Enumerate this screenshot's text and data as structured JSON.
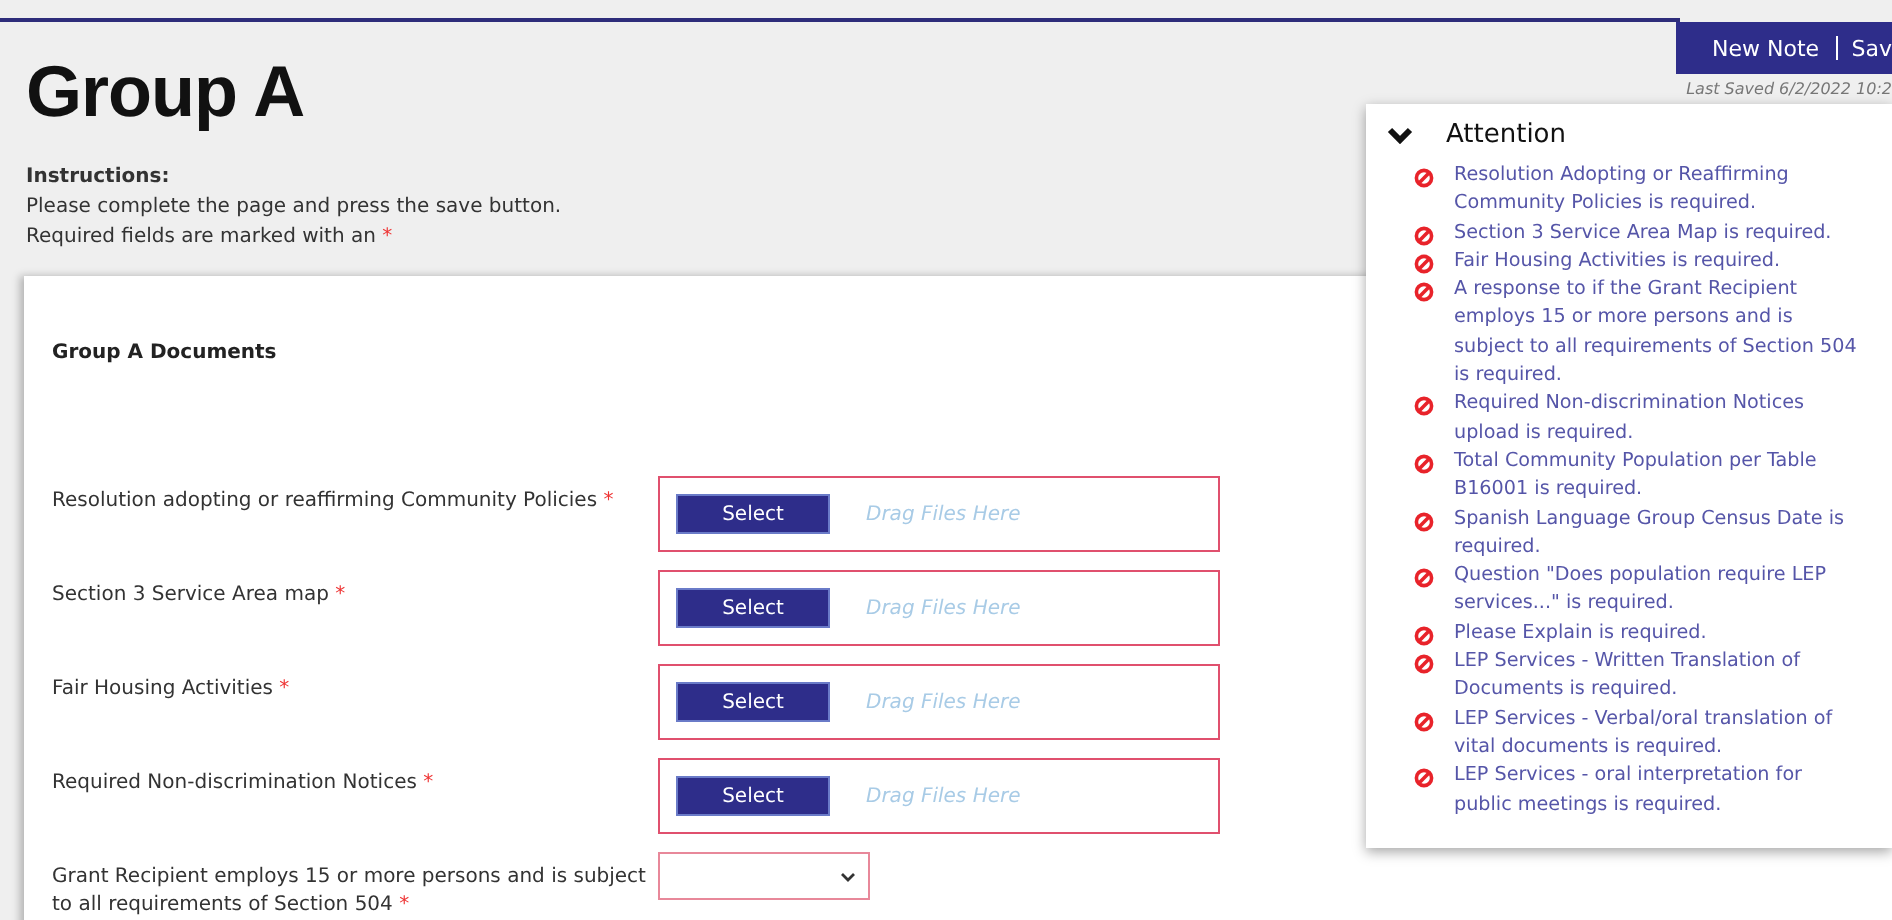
{
  "header": {
    "title": "Group A",
    "actions": [
      "New Note",
      "Sav"
    ],
    "last_saved": "Last Saved 6/2/2022 10:2"
  },
  "instructions": {
    "heading": "Instructions:",
    "lines": [
      "Please complete the page and press the save button.",
      "Required fields are marked with an"
    ],
    "mark": "*"
  },
  "section": {
    "title": "Group A Documents",
    "fields": [
      {
        "kind": "file",
        "label": "Resolution adopting or reaffirming Community Policies",
        "required_mark": "*",
        "button": "Select",
        "hint": "Drag Files Here"
      },
      {
        "kind": "file",
        "label": "Section 3 Service Area map",
        "required_mark": "*",
        "button": "Select",
        "hint": "Drag Files Here"
      },
      {
        "kind": "file",
        "label": "Fair Housing Activities",
        "required_mark": "*",
        "button": "Select",
        "hint": "Drag Files Here"
      },
      {
        "kind": "file",
        "label": "Required Non-discrimination Notices",
        "required_mark": "*",
        "button": "Select",
        "hint": "Drag Files Here"
      },
      {
        "kind": "select",
        "label": "Grant Recipient employs 15 or more persons and is subject to all requirements of Section 504",
        "required_mark": "*"
      }
    ]
  },
  "attention": {
    "title": "Attention",
    "expanded": true,
    "messages": [
      "Resolution Adopting or Reaffirming Community Policies is required.",
      "Section 3 Service Area Map is required.",
      "Fair Housing Activities is required.",
      "A response to if the Grant Recipient employs 15 or more persons and is subject to all requirements of Section 504 is required.",
      "Required Non-discrimination Notices upload is required.",
      "Total Community Population per Table B16001 is required.",
      "Spanish Language Group Census Date is required.",
      "Question \"Does population require LEP services...\" is required.",
      "Please Explain is required.",
      "LEP Services - Written Translation of Documents is required.",
      "LEP Services - Verbal/oral translation of vital documents is required.",
      "LEP Services - oral interpretation for public meetings is required."
    ]
  }
}
